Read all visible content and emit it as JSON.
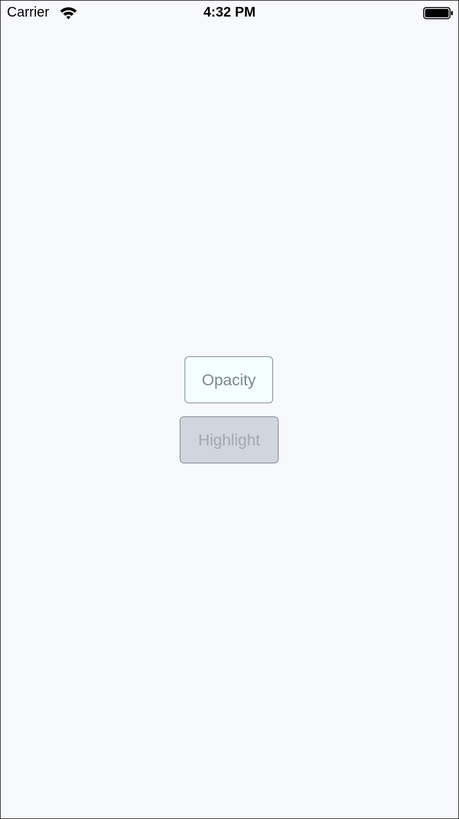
{
  "status_bar": {
    "carrier": "Carrier",
    "time": "4:32 PM",
    "wifi_icon": "wifi-icon",
    "battery_icon": "battery-full-icon"
  },
  "buttons": {
    "opacity_label": "Opacity",
    "highlight_label": "Highlight"
  },
  "colors": {
    "background": "#f8f9fc",
    "opacity_button_fill": "#f4ffff",
    "highlight_button_fill": "#d1d5dd",
    "button_border": "#7c8590",
    "opacity_text": "#7c8590",
    "highlight_text": "#a2a8b1"
  }
}
